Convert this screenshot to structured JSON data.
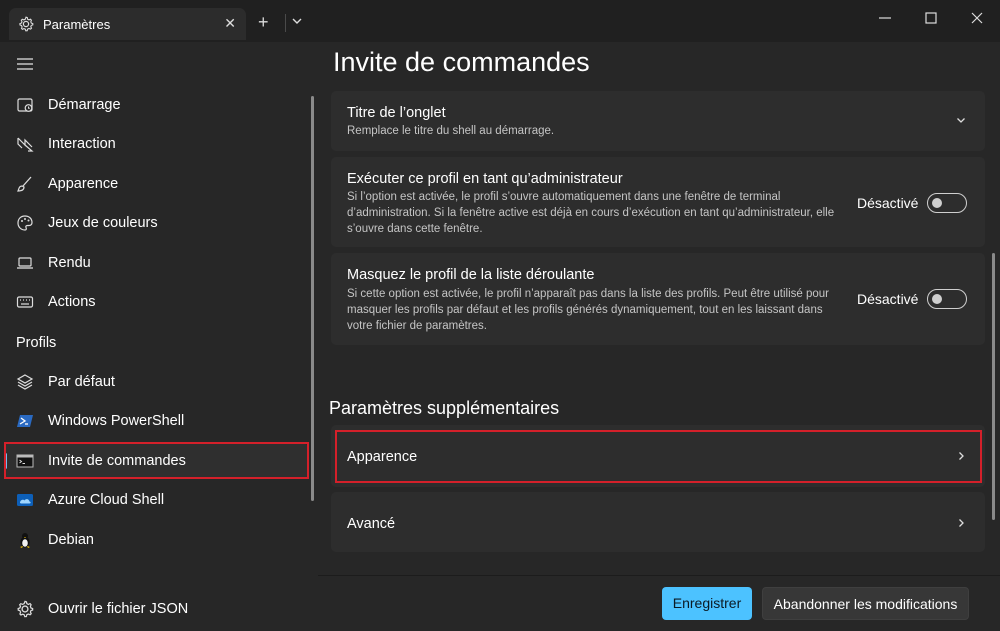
{
  "window": {
    "tab_title": "Paramètres",
    "tab_close": "✕",
    "new_tab": "+"
  },
  "page": {
    "title": "Invite de commandes"
  },
  "sidebar": {
    "items": [
      {
        "label": "Démarrage",
        "icon": "startup-icon"
      },
      {
        "label": "Interaction",
        "icon": "interaction-icon"
      },
      {
        "label": "Apparence",
        "icon": "brush-icon"
      },
      {
        "label": "Jeux de couleurs",
        "icon": "palette-icon"
      },
      {
        "label": "Rendu",
        "icon": "monitor-icon"
      },
      {
        "label": "Actions",
        "icon": "keyboard-icon"
      }
    ],
    "profiles_header": "Profils",
    "profiles": [
      {
        "label": "Par défaut",
        "icon": "layers-icon"
      },
      {
        "label": "Windows PowerShell",
        "icon": "powershell-icon"
      },
      {
        "label": "Invite de commandes",
        "icon": "cmd-icon",
        "selected": true
      },
      {
        "label": "Azure Cloud Shell",
        "icon": "azure-icon"
      },
      {
        "label": "Debian",
        "icon": "linux-icon"
      }
    ],
    "open_json": "Ouvrir le fichier JSON"
  },
  "settings": {
    "tab_title": {
      "title": "Titre de l’onglet",
      "desc": "Remplace le titre du shell au démarrage."
    },
    "run_admin": {
      "title": "Exécuter ce profil en tant qu’administrateur",
      "desc": "Si l’option est activée, le profil s’ouvre automatiquement dans une fenêtre de terminal d’administration. Si la fenêtre active est déjà en cours d’exécution en tant qu’administrateur, elle s’ouvre dans cette fenêtre.",
      "state": "Désactivé"
    },
    "hide_profile": {
      "title": "Masquez le profil de la liste déroulante",
      "desc": "Si cette option est activée, le profil n’apparaît pas dans la liste des profils. Peut être utilisé pour masquer les profils par défaut et les profils générés dynamiquement, tout en les laissant dans votre fichier de paramètres.",
      "state": "Désactivé"
    }
  },
  "additional": {
    "heading": "Paramètres supplémentaires",
    "appearance": "Apparence",
    "advanced": "Avancé"
  },
  "footer": {
    "save": "Enregistrer",
    "discard": "Abandonner les modifications"
  },
  "colors": {
    "accent": "#4cc2ff",
    "highlight": "#d4202a"
  }
}
